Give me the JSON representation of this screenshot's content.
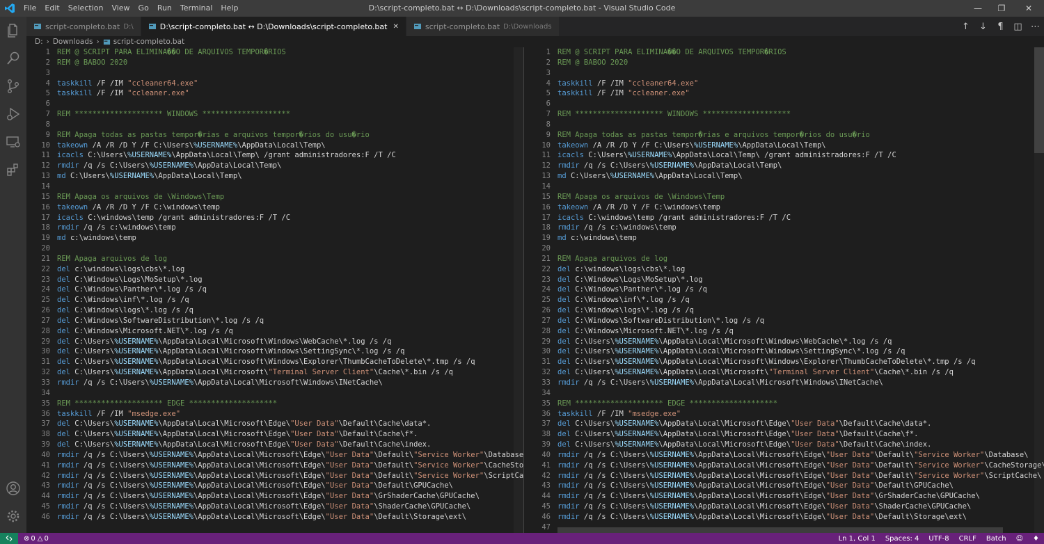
{
  "titlebar": {
    "menu": [
      "File",
      "Edit",
      "Selection",
      "View",
      "Go",
      "Run",
      "Terminal",
      "Help"
    ],
    "title": "D:\\script-completo.bat ↔ D:\\Downloads\\script-completo.bat - Visual Studio Code"
  },
  "tabs": [
    {
      "label": "script-completo.bat",
      "detail": "D:\\"
    },
    {
      "label": "D:\\script-completo.bat ↔ D:\\Downloads\\script-completo.bat",
      "detail": ""
    },
    {
      "label": "script-completo.bat",
      "detail": "D:\\Downloads"
    }
  ],
  "breadcrumb": [
    "D:",
    "Downloads",
    "script-completo.bat"
  ],
  "editor": {
    "lines": [
      {
        "n": "1",
        "t": [
          [
            "REM @ SCRIPT PARA ELIMINA��O DE ARQUIVOS TEMPOR�RIOS",
            "com"
          ]
        ]
      },
      {
        "n": "2",
        "t": [
          [
            "REM @ BABOO 2020",
            "com"
          ]
        ]
      },
      {
        "n": "3",
        "t": []
      },
      {
        "n": "4",
        "t": [
          [
            "taskkill",
            "key"
          ],
          [
            " /F /IM ",
            ""
          ],
          [
            "\"ccleaner64.exe\"",
            "str"
          ]
        ]
      },
      {
        "n": "5",
        "t": [
          [
            "taskkill",
            "key"
          ],
          [
            " /F /IM ",
            ""
          ],
          [
            "\"ccleaner.exe\"",
            "str"
          ]
        ]
      },
      {
        "n": "6",
        "t": []
      },
      {
        "n": "7",
        "t": [
          [
            "REM ******************** WINDOWS ********************",
            "com"
          ]
        ]
      },
      {
        "n": "8",
        "t": []
      },
      {
        "n": "9",
        "t": [
          [
            "REM Apaga todas as pastas tempor�rias e arquivos tempor�rios do usu�rio",
            "com"
          ]
        ]
      },
      {
        "n": "10",
        "t": [
          [
            "takeown",
            "key"
          ],
          [
            " /A /R /D Y /F C:\\Users\\",
            ""
          ],
          [
            "%USERNAME%",
            "var"
          ],
          [
            "\\AppData\\Local\\Temp\\",
            ""
          ]
        ]
      },
      {
        "n": "11",
        "t": [
          [
            "icacls",
            "key"
          ],
          [
            " C:\\Users\\",
            ""
          ],
          [
            "%USERNAME%",
            "var"
          ],
          [
            "\\AppData\\Local\\Temp\\ /grant administradores:F /T /C",
            ""
          ]
        ]
      },
      {
        "n": "12",
        "t": [
          [
            "rmdir",
            "key"
          ],
          [
            " /q /s C:\\Users\\",
            ""
          ],
          [
            "%USERNAME%",
            "var"
          ],
          [
            "\\AppData\\Local\\Temp\\",
            ""
          ]
        ]
      },
      {
        "n": "13",
        "t": [
          [
            "md",
            "key"
          ],
          [
            " C:\\Users\\",
            ""
          ],
          [
            "%USERNAME%",
            "var"
          ],
          [
            "\\AppData\\Local\\Temp\\",
            ""
          ]
        ]
      },
      {
        "n": "14",
        "t": []
      },
      {
        "n": "15",
        "t": [
          [
            "REM Apaga os arquivos de \\Windows\\Temp",
            "com"
          ]
        ]
      },
      {
        "n": "16",
        "t": [
          [
            "takeown",
            "key"
          ],
          [
            " /A /R /D Y /F C:\\windows\\temp",
            ""
          ]
        ]
      },
      {
        "n": "17",
        "t": [
          [
            "icacls",
            "key"
          ],
          [
            " C:\\windows\\temp /grant administradores:F /T /C",
            ""
          ]
        ]
      },
      {
        "n": "18",
        "t": [
          [
            "rmdir",
            "key"
          ],
          [
            " /q /s c:\\windows\\temp",
            ""
          ]
        ]
      },
      {
        "n": "19",
        "t": [
          [
            "md",
            "key"
          ],
          [
            " c:\\windows\\temp",
            ""
          ]
        ]
      },
      {
        "n": "20",
        "t": []
      },
      {
        "n": "21",
        "t": [
          [
            "REM Apaga arquivos de log",
            "com"
          ]
        ]
      },
      {
        "n": "22",
        "t": [
          [
            "del",
            "key"
          ],
          [
            " c:\\windows\\logs\\cbs\\*.log",
            ""
          ]
        ]
      },
      {
        "n": "23",
        "t": [
          [
            "del",
            "key"
          ],
          [
            " C:\\Windows\\Logs\\MoSetup\\*.log",
            ""
          ]
        ]
      },
      {
        "n": "24",
        "t": [
          [
            "del",
            "key"
          ],
          [
            " C:\\Windows\\Panther\\*.log /s /q",
            ""
          ]
        ]
      },
      {
        "n": "25",
        "t": [
          [
            "del",
            "key"
          ],
          [
            " C:\\Windows\\inf\\*.log /s /q",
            ""
          ]
        ]
      },
      {
        "n": "26",
        "t": [
          [
            "del",
            "key"
          ],
          [
            " C:\\Windows\\logs\\*.log /s /q",
            ""
          ]
        ]
      },
      {
        "n": "27",
        "t": [
          [
            "del",
            "key"
          ],
          [
            " C:\\Windows\\SoftwareDistribution\\*.log /s /q",
            ""
          ]
        ]
      },
      {
        "n": "28",
        "t": [
          [
            "del",
            "key"
          ],
          [
            " C:\\Windows\\Microsoft.NET\\*.log /s /q",
            ""
          ]
        ]
      },
      {
        "n": "29",
        "t": [
          [
            "del",
            "key"
          ],
          [
            " C:\\Users\\",
            ""
          ],
          [
            "%USERNAME%",
            "var"
          ],
          [
            "\\AppData\\Local\\Microsoft\\Windows\\WebCache\\*.log /s /q",
            ""
          ]
        ]
      },
      {
        "n": "30",
        "t": [
          [
            "del",
            "key"
          ],
          [
            " C:\\Users\\",
            ""
          ],
          [
            "%USERNAME%",
            "var"
          ],
          [
            "\\AppData\\Local\\Microsoft\\Windows\\SettingSync\\*.log /s /q",
            ""
          ]
        ]
      },
      {
        "n": "31",
        "t": [
          [
            "del",
            "key"
          ],
          [
            " C:\\Users\\",
            ""
          ],
          [
            "%USERNAME%",
            "var"
          ],
          [
            "\\AppData\\Local\\Microsoft\\Windows\\Explorer\\ThumbCacheToDelete\\*.tmp /s /q",
            ""
          ]
        ]
      },
      {
        "n": "32",
        "t": [
          [
            "del",
            "key"
          ],
          [
            " C:\\Users\\",
            ""
          ],
          [
            "%USERNAME%",
            "var"
          ],
          [
            "\\AppData\\Local\\Microsoft\\",
            ""
          ],
          [
            "\"Terminal Server Client\"",
            "str"
          ],
          [
            "\\Cache\\*.bin /s /q",
            ""
          ]
        ]
      },
      {
        "n": "33",
        "t": [
          [
            "rmdir",
            "key"
          ],
          [
            " /q /s C:\\Users\\",
            ""
          ],
          [
            "%USERNAME%",
            "var"
          ],
          [
            "\\AppData\\Local\\Microsoft\\Windows\\INetCache\\",
            ""
          ]
        ]
      },
      {
        "n": "34",
        "t": []
      },
      {
        "n": "35",
        "t": [
          [
            "REM ******************** EDGE ********************",
            "com"
          ]
        ]
      },
      {
        "n": "36",
        "t": [
          [
            "taskkill",
            "key"
          ],
          [
            " /F /IM ",
            ""
          ],
          [
            "\"msedge.exe\"",
            "str"
          ]
        ]
      },
      {
        "n": "37",
        "t": [
          [
            "del",
            "key"
          ],
          [
            " C:\\Users\\",
            ""
          ],
          [
            "%USERNAME%",
            "var"
          ],
          [
            "\\AppData\\Local\\Microsoft\\Edge\\",
            ""
          ],
          [
            "\"User Data\"",
            "str"
          ],
          [
            "\\Default\\Cache\\data*.",
            ""
          ]
        ]
      },
      {
        "n": "38",
        "t": [
          [
            "del",
            "key"
          ],
          [
            " C:\\Users\\",
            ""
          ],
          [
            "%USERNAME%",
            "var"
          ],
          [
            "\\AppData\\Local\\Microsoft\\Edge\\",
            ""
          ],
          [
            "\"User Data\"",
            "str"
          ],
          [
            "\\Default\\Cache\\f*.",
            ""
          ]
        ]
      },
      {
        "n": "39",
        "t": [
          [
            "del",
            "key"
          ],
          [
            " C:\\Users\\",
            ""
          ],
          [
            "%USERNAME%",
            "var"
          ],
          [
            "\\AppData\\Local\\Microsoft\\Edge\\",
            ""
          ],
          [
            "\"User Data\"",
            "str"
          ],
          [
            "\\Default\\Cache\\index.",
            ""
          ]
        ]
      },
      {
        "n": "40",
        "t": [
          [
            "rmdir",
            "key"
          ],
          [
            " /q /s C:\\Users\\",
            ""
          ],
          [
            "%USERNAME%",
            "var"
          ],
          [
            "\\AppData\\Local\\Microsoft\\Edge\\",
            ""
          ],
          [
            "\"User Data\"",
            "str"
          ],
          [
            "\\Default\\",
            ""
          ],
          [
            "\"Service Worker\"",
            "str"
          ],
          [
            "\\Database\\",
            ""
          ]
        ]
      },
      {
        "n": "41",
        "t": [
          [
            "rmdir",
            "key"
          ],
          [
            " /q /s C:\\Users\\",
            ""
          ],
          [
            "%USERNAME%",
            "var"
          ],
          [
            "\\AppData\\Local\\Microsoft\\Edge\\",
            ""
          ],
          [
            "\"User Data\"",
            "str"
          ],
          [
            "\\Default\\",
            ""
          ],
          [
            "\"Service Worker\"",
            "str"
          ],
          [
            "\\CacheStorage\\",
            ""
          ]
        ]
      },
      {
        "n": "42",
        "t": [
          [
            "rmdir",
            "key"
          ],
          [
            " /q /s C:\\Users\\",
            ""
          ],
          [
            "%USERNAME%",
            "var"
          ],
          [
            "\\AppData\\Local\\Microsoft\\Edge\\",
            ""
          ],
          [
            "\"User Data\"",
            "str"
          ],
          [
            "\\Default\\",
            ""
          ],
          [
            "\"Service Worker\"",
            "str"
          ],
          [
            "\\ScriptCache\\",
            ""
          ]
        ]
      },
      {
        "n": "43",
        "t": [
          [
            "rmdir",
            "key"
          ],
          [
            " /q /s C:\\Users\\",
            ""
          ],
          [
            "%USERNAME%",
            "var"
          ],
          [
            "\\AppData\\Local\\Microsoft\\Edge\\",
            ""
          ],
          [
            "\"User Data\"",
            "str"
          ],
          [
            "\\Default\\GPUCache\\",
            ""
          ]
        ]
      },
      {
        "n": "44",
        "t": [
          [
            "rmdir",
            "key"
          ],
          [
            " /q /s C:\\Users\\",
            ""
          ],
          [
            "%USERNAME%",
            "var"
          ],
          [
            "\\AppData\\Local\\Microsoft\\Edge\\",
            ""
          ],
          [
            "\"User Data\"",
            "str"
          ],
          [
            "\\GrShaderCache\\GPUCache\\",
            ""
          ]
        ]
      },
      {
        "n": "45",
        "t": [
          [
            "rmdir",
            "key"
          ],
          [
            " /q /s C:\\Users\\",
            ""
          ],
          [
            "%USERNAME%",
            "var"
          ],
          [
            "\\AppData\\Local\\Microsoft\\Edge\\",
            ""
          ],
          [
            "\"User Data\"",
            "str"
          ],
          [
            "\\ShaderCache\\GPUCache\\",
            ""
          ]
        ]
      },
      {
        "n": "46",
        "t": [
          [
            "rmdir",
            "key"
          ],
          [
            " /q /s C:\\Users\\",
            ""
          ],
          [
            "%USERNAME%",
            "var"
          ],
          [
            "\\AppData\\Local\\Microsoft\\Edge\\",
            ""
          ],
          [
            "\"User Data\"",
            "str"
          ],
          [
            "\\Default\\Storage\\ext\\",
            ""
          ]
        ]
      },
      {
        "n": "47",
        "t": []
      }
    ]
  },
  "status": {
    "problems": "0",
    "warnings": "0",
    "position": "Ln 1, Col 1",
    "spaces": "Spaces: 4",
    "encoding": "UTF-8",
    "eol": "CRLF",
    "language": "Batch"
  },
  "colors": {
    "comment": "#6a9955",
    "keyword": "#569cd6",
    "string": "#ce9178",
    "variable": "#9cdcfe",
    "statusbar": "#68217a",
    "remote": "#16825d",
    "file_icon": "#519aba"
  },
  "icons": [
    "vscode-logo-icon",
    "explorer-icon",
    "search-icon",
    "source-control-icon",
    "run-debug-icon",
    "remote-explorer-icon",
    "extensions-icon",
    "account-icon",
    "settings-gear-icon",
    "file-bat-icon",
    "previous-change-icon",
    "next-change-icon",
    "whitespace-icon",
    "split-editor-icon",
    "more-actions-icon",
    "remote-icon",
    "error-icon",
    "warning-icon",
    "feedback-icon",
    "bell-icon"
  ]
}
